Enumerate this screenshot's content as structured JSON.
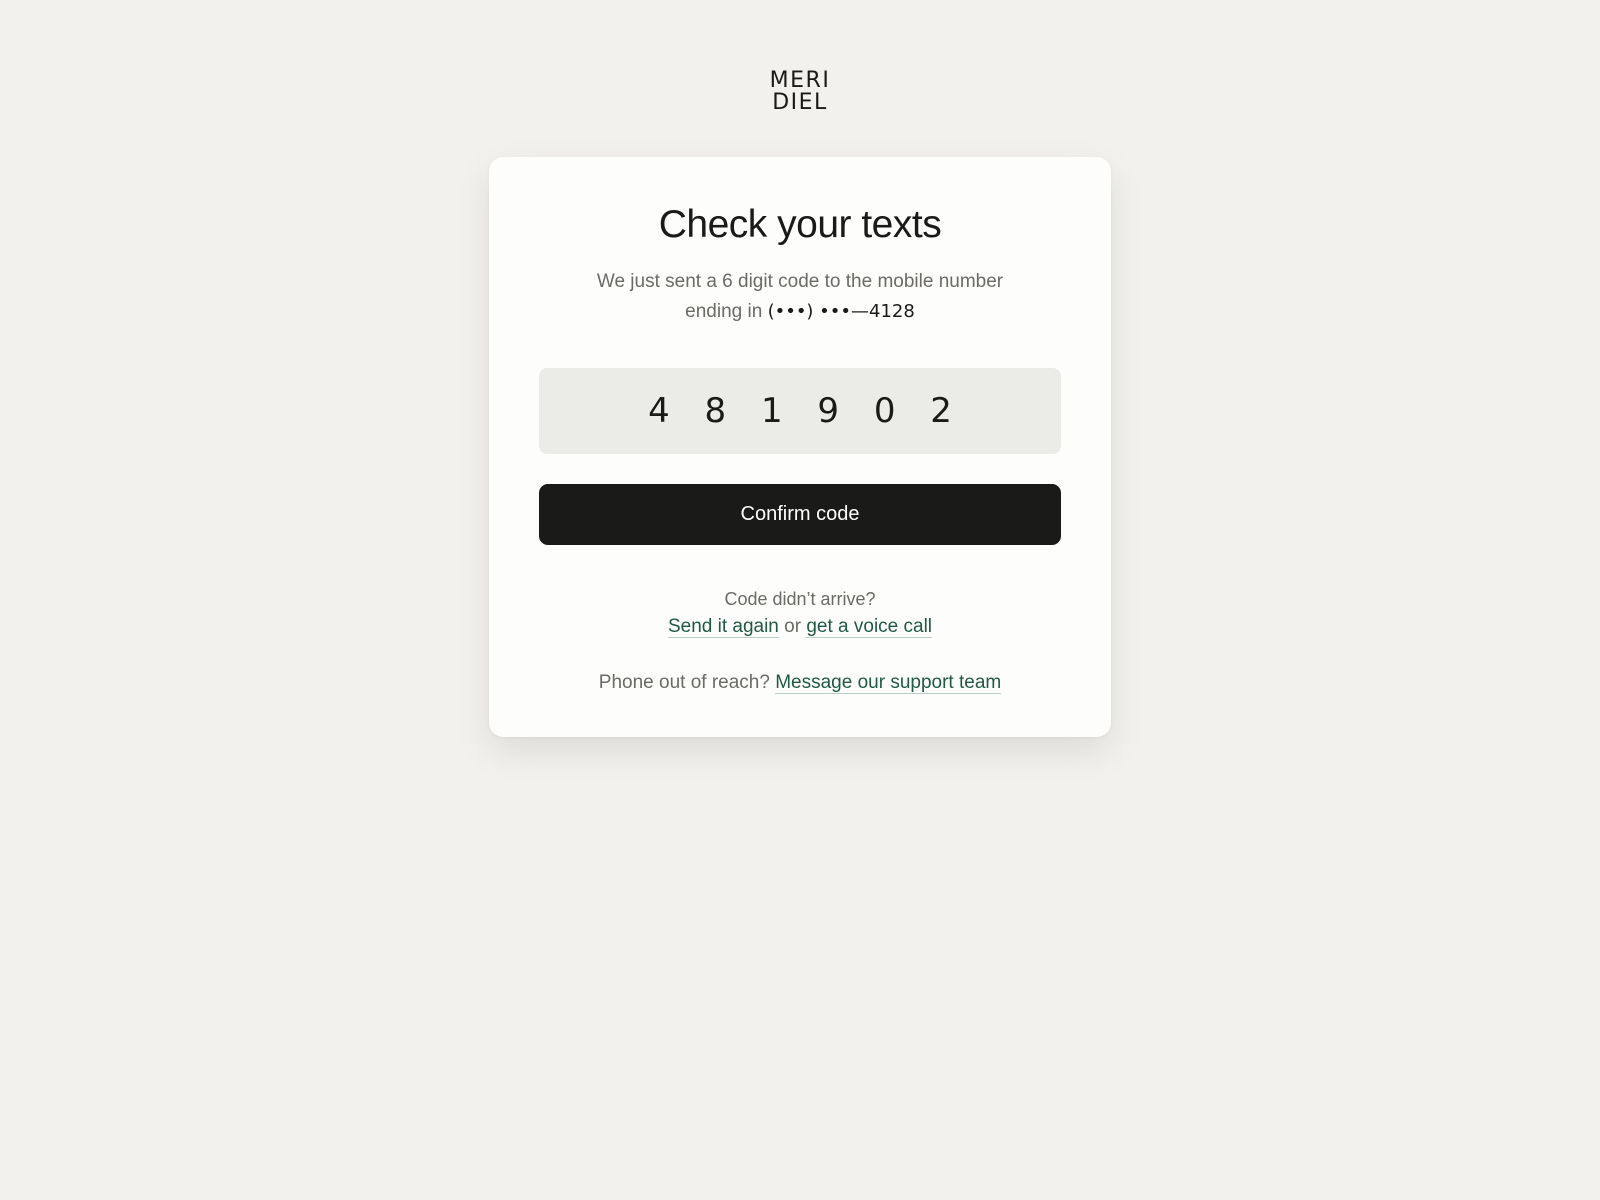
{
  "brand": {
    "logo_line1": "MERI",
    "logo_line2": "DIEL"
  },
  "card": {
    "title": "Check your texts",
    "subtitle_prefix": "We just sent a 6 digit code to the mobile number ending in",
    "masked_number": "(•••) •••—4128",
    "code_value": "4 8 1 9 0 2",
    "confirm_label": "Confirm code",
    "resend_question": "Code didn’t arrive?",
    "send_again_label": "Send it again",
    "or_text": "or",
    "voice_call_label": "get a voice call",
    "support_question": "Phone out of reach?",
    "support_link_label": "Message our support team"
  },
  "colors": {
    "background": "#f2f1ee",
    "card": "#fdfdfb",
    "primary_button": "#1a1a18",
    "link": "#1f5a44"
  }
}
